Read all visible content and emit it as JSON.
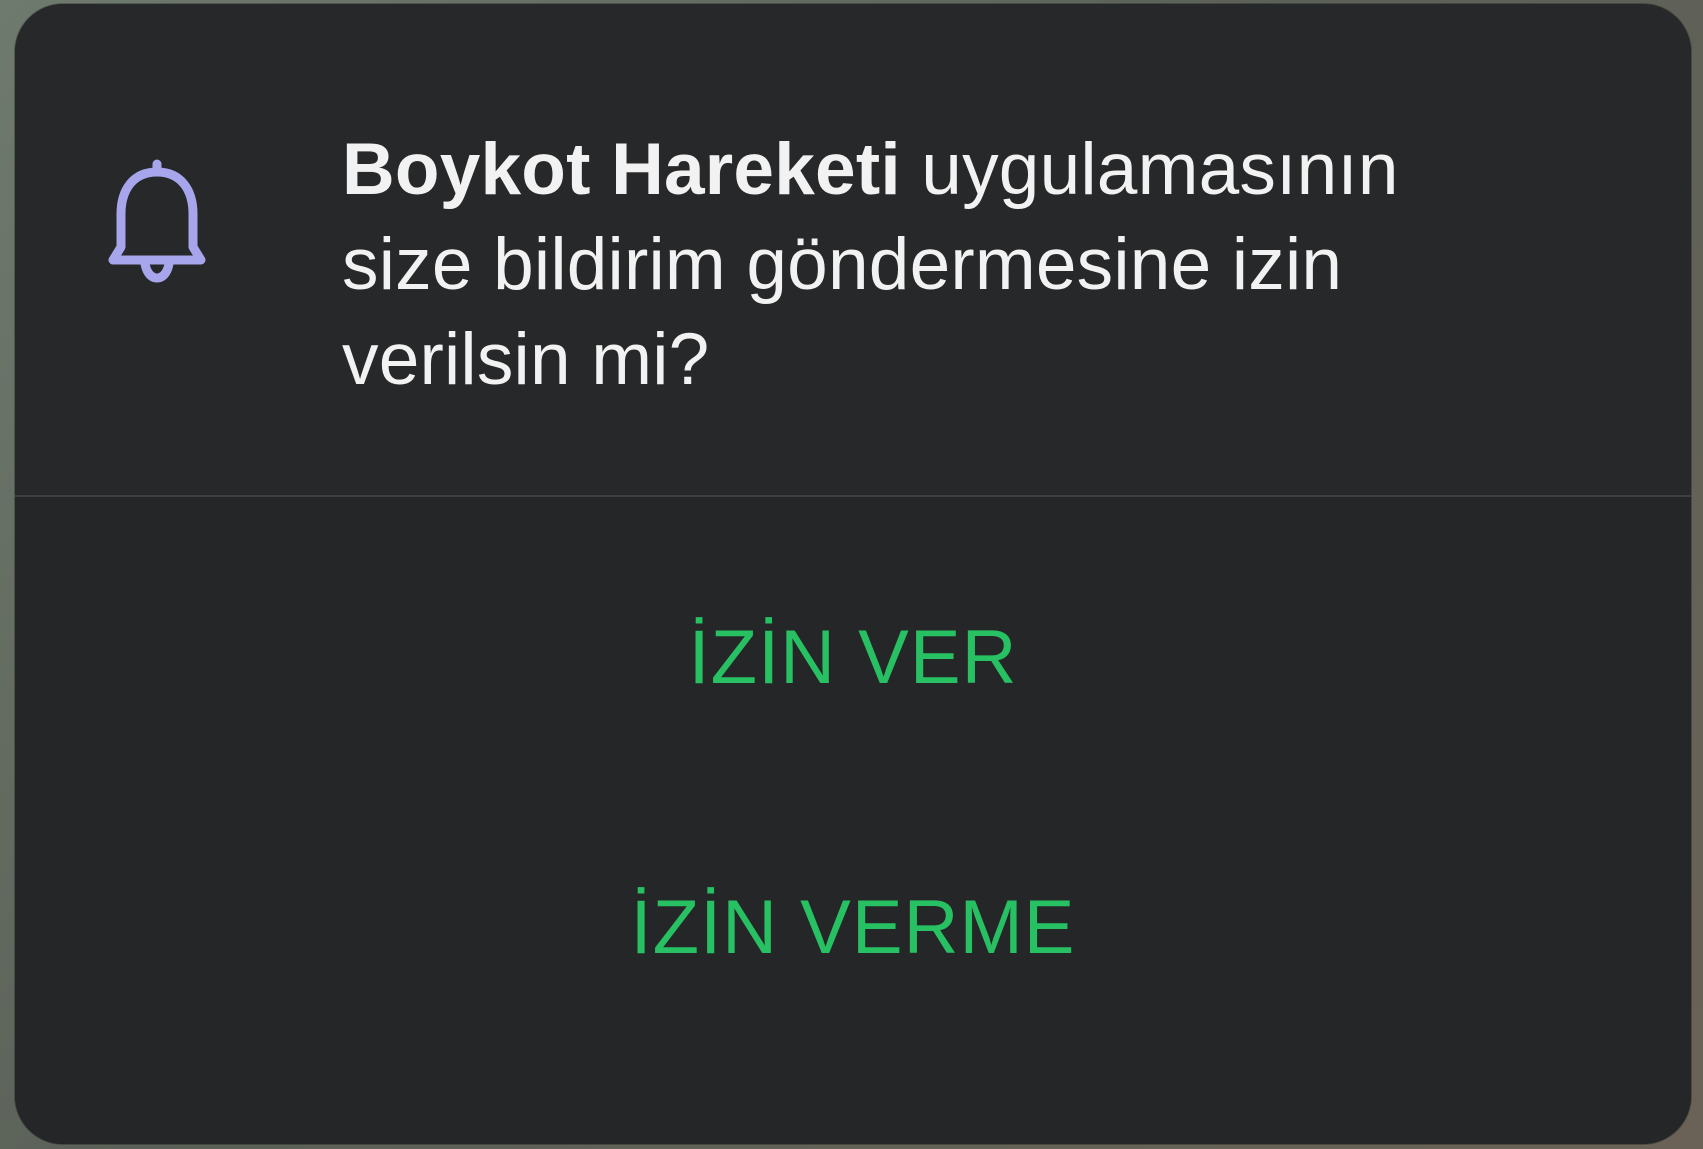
{
  "dialog": {
    "app_name": "Boykot Hareketi",
    "message_line1_rest": " uygulamasının",
    "message_line2": "size bildirim göndermesine izin",
    "message_line3": "verilsin mi?",
    "icon": "bell-icon",
    "icon_color": "#a7a6ec",
    "accent_color": "#27c063"
  },
  "actions": {
    "allow_label": "İZİN VER",
    "deny_label": "İZİN VERME"
  }
}
